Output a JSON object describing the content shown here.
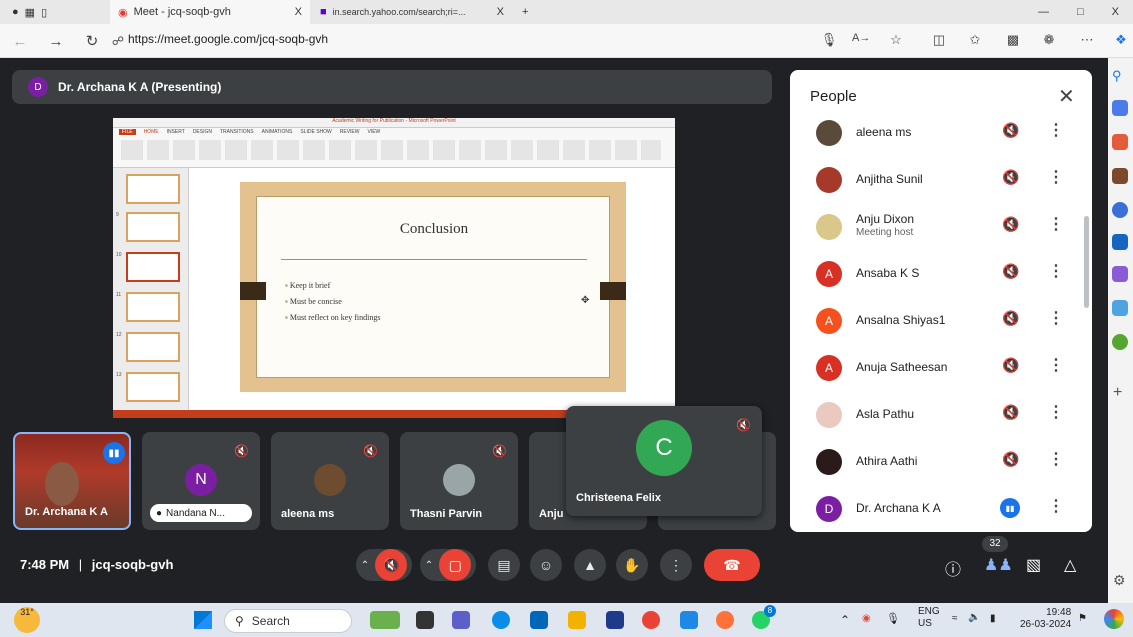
{
  "browser": {
    "tab1_title": "Meet - jcq-soqb-gvh",
    "tab1_close": "X",
    "tab2_title": "in.search.yahoo.com/search;ri=...",
    "tab2_close": "X",
    "new_tab": "+",
    "url": "https://meet.google.com/jcq-soqb-gvh",
    "window_controls": [
      "—",
      "□",
      "X"
    ]
  },
  "meet": {
    "presenter_initial": "D",
    "presenter_label": "Dr. Archana K A (Presenting)",
    "time": "7:48 PM",
    "separator": "|",
    "meeting_code": "jcq-soqb-gvh",
    "participant_count": "32"
  },
  "shared_screen": {
    "window_title": "Academic Writing for Publication - Microsoft PowerPoint",
    "ribbon_tabs": [
      "FILE",
      "HOME",
      "INSERT",
      "DESIGN",
      "TRANSITIONS",
      "ANIMATIONS",
      "SLIDE SHOW",
      "REVIEW",
      "VIEW"
    ],
    "thumb_numbers": [
      "9",
      "10",
      "11",
      "12",
      "13"
    ],
    "slide_title": "Conclusion",
    "bullets": [
      "Keep it brief",
      "Must be concise",
      "Must reflect on key findings"
    ]
  },
  "tiles": [
    {
      "name": "Dr. Archana K A"
    },
    {
      "name": "Nandana N...",
      "initial": "N"
    },
    {
      "name": "aleena ms"
    },
    {
      "name": "Thasni Parvin"
    },
    {
      "name": "Anju"
    }
  ],
  "christeena": {
    "initial": "C",
    "name": "Christeena Felix"
  },
  "people": {
    "title": "People",
    "close": "✕",
    "list": [
      {
        "name": "aleena ms",
        "sub": ""
      },
      {
        "name": "Anjitha Sunil",
        "sub": ""
      },
      {
        "name": "Anju Dixon",
        "sub": "Meeting host"
      },
      {
        "name": "Ansaba K S",
        "sub": "",
        "initial": "A"
      },
      {
        "name": "Ansalna Shiyas1",
        "sub": "",
        "initial": "A"
      },
      {
        "name": "Anuja Satheesan",
        "sub": "",
        "initial": "A"
      },
      {
        "name": "Asla Pathu",
        "sub": ""
      },
      {
        "name": "Athira Aathi",
        "sub": ""
      },
      {
        "name": "Dr. Archana K A",
        "sub": "",
        "initial": "D"
      }
    ]
  },
  "taskbar": {
    "weather": "31°",
    "search_placeholder": "Search",
    "lang1": "ENG",
    "lang2": "US",
    "clock_time": "19:48",
    "clock_date": "26-03-2024",
    "badge": "8"
  },
  "colors": {
    "meet_bg": "#202124",
    "tile_bg": "#3c4043",
    "end_call": "#ea4335",
    "avatar_purple": "#7b1fa2",
    "avatar_red": "#d93025",
    "avatar_orange": "#f4511e",
    "avatar_green": "#33a854",
    "ppt_red": "#c43e1c"
  }
}
